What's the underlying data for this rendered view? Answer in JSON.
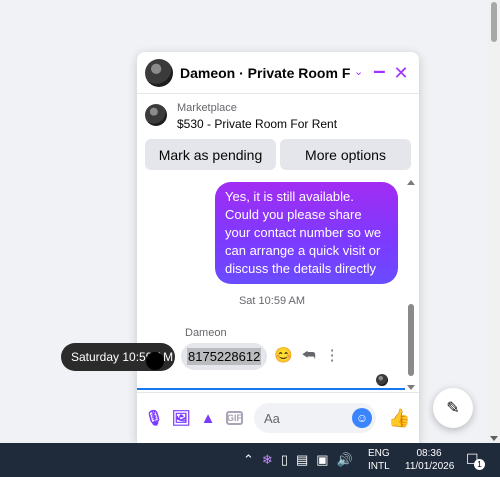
{
  "chat": {
    "title": "Dameon · Private Room Fo...",
    "header_icons": {
      "chevron": "chevron-down-icon",
      "minimize": "minimize-icon",
      "close": "close-icon"
    },
    "accent_color": "#a033ff"
  },
  "listing": {
    "category": "Marketplace",
    "title": "$530 - Private Room For Rent",
    "buttons": {
      "mark_pending": "Mark as pending",
      "more_options": "More options"
    }
  },
  "messages": {
    "outgoing": "Yes, it is still available. Could you please share your contact number so we can arrange a quick visit or discuss the details directly",
    "timestamp": "Sat 10:59 AM",
    "sender": "Dameon",
    "incoming": "8175228612",
    "actions": {
      "react": "😊",
      "reply": "⮪",
      "more": "⋮"
    }
  },
  "tooltip": {
    "text": "Saturday 10:59 AM"
  },
  "composer": {
    "placeholder": "Aa",
    "icons": [
      "microphone-icon",
      "photo-icon",
      "sticker-icon",
      "gif-icon",
      "emoji-icon",
      "like-icon"
    ],
    "gif_label": "GIF"
  },
  "taskbar": {
    "tray_icons": [
      "chevron-up-icon",
      "feather-icon",
      "phone-link-icon",
      "battery-icon",
      "network-icon",
      "volume-icon"
    ],
    "lang_top": "ENG",
    "lang_bottom": "INTL",
    "time": "08:36",
    "date": "11/01/2026",
    "notification_count": "1"
  }
}
